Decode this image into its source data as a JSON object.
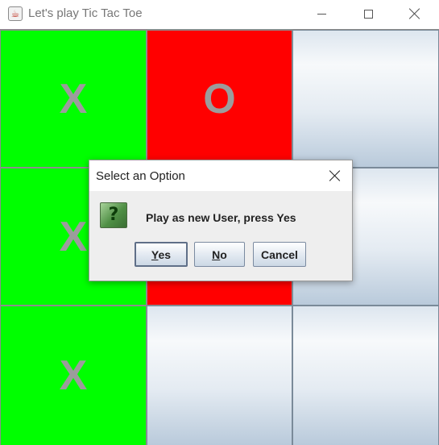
{
  "window": {
    "title": "Let's play Tic Tac Toe",
    "icon": "java-cup-icon"
  },
  "board": {
    "cells": [
      {
        "mark": "X",
        "color": "#00ff00"
      },
      {
        "mark": "O",
        "color": "#ff0000"
      },
      {
        "mark": "",
        "color": "empty"
      },
      {
        "mark": "X",
        "color": "#00ff00"
      },
      {
        "mark": "",
        "color": "#ff0000"
      },
      {
        "mark": "",
        "color": "empty"
      },
      {
        "mark": "X",
        "color": "#00ff00"
      },
      {
        "mark": "",
        "color": "empty"
      },
      {
        "mark": "",
        "color": "empty"
      }
    ]
  },
  "dialog": {
    "title": "Select an Option",
    "icon": "question-icon",
    "icon_glyph": "?",
    "message": "Play as new User, press Yes",
    "buttons": {
      "yes": {
        "mnemonic": "Y",
        "rest": "es"
      },
      "no": {
        "mnemonic": "N",
        "rest": "o"
      },
      "cancel": {
        "label": "Cancel"
      }
    }
  }
}
